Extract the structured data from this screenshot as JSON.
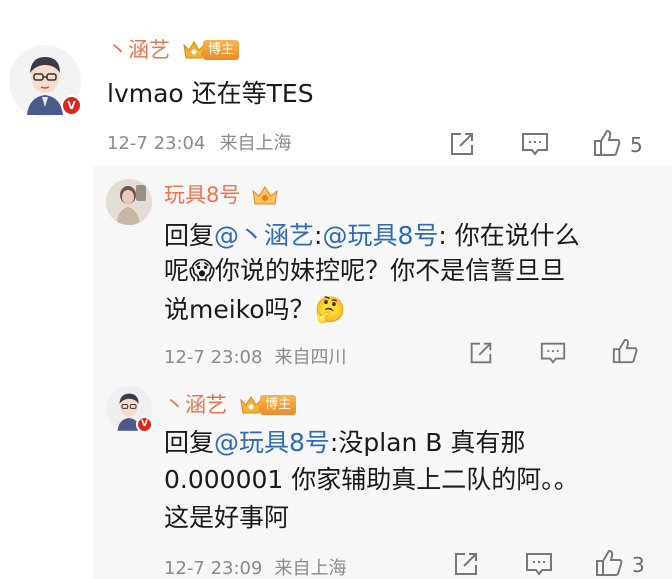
{
  "comment": {
    "username": "丶涵艺",
    "badge_label": "博主",
    "badge_icon": "crown-icon",
    "verified_mark": "V",
    "text": "lvmao 还在等TES",
    "time": "12-7 23:04",
    "location": "来自上海",
    "like_count": "5"
  },
  "replies": [
    {
      "username": "玩具8号",
      "prefix": "回复",
      "mention1": "@丶涵艺",
      "mention_sep": ":",
      "mention2": "@玩具8号",
      "line1_rest": ": 你在说什么",
      "line2": "呢😱你说的妹控呢？你不是信誓旦旦",
      "line3": "说meiko吗？🤔",
      "time": "12-7 23:08",
      "location": "来自四川"
    },
    {
      "username": "丶涵艺",
      "badge_label": "博主",
      "verified_mark": "V",
      "prefix": "回复",
      "mention1": "@玩具8号",
      "line1_rest": ":没plan B 真有那",
      "line2": "0.000001 你家辅助真上二队的阿。。",
      "line3": "这是好事阿",
      "time": "12-7 23:09",
      "location": "来自上海",
      "like_count": "3"
    }
  ],
  "icons": {
    "share": "share-icon",
    "comment": "comment-icon",
    "like": "thumbs-up-icon"
  },
  "colors": {
    "username": "#eb7350",
    "mention": "#2f6bb6",
    "meta": "#8a8a8a",
    "verified": "#e2231a"
  }
}
